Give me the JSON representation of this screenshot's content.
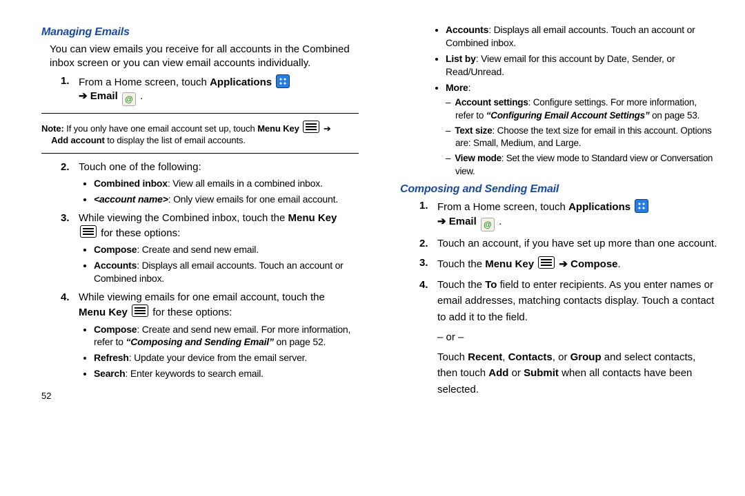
{
  "left": {
    "section_title": "Managing Emails",
    "intro": "You can view emails you receive for all accounts in the Combined inbox screen or you can view email accounts individually.",
    "step1_a": "From a Home screen, touch ",
    "step1_b": "Applications",
    "arrow": " ➔ ",
    "email_label": "Email",
    "period": " .",
    "note_bold": "Note:",
    "note_text_a": " If you only have one email account set up, touch ",
    "note_menu": "Menu Key",
    "note_text_b": "Add account",
    "note_text_c": " to display the list of email accounts.",
    "step2": "Touch one of the following:",
    "step2_b1_bold": "Combined inbox",
    "step2_b1_rest": ": View all emails in a combined inbox.",
    "step2_b2_tag": "<account name>",
    "step2_b2_rest": ": Only view emails for one email account.",
    "step3_a": "While viewing the Combined inbox, touch the ",
    "step3_b": "Menu Key",
    "step3_c": " for these options:",
    "s3b1_bold": "Compose",
    "s3b1_rest": ": Create and send new email.",
    "s3b2_bold": "Accounts",
    "s3b2_rest": ": Displays all email accounts. Touch an account or Combined inbox.",
    "step4_a": "While viewing emails for one email account, touch the ",
    "step4_b": "Menu Key",
    "step4_c": "  for these options:",
    "s4b1_bold": "Compose",
    "s4b1_rest": ": Create and send new email. For more information, refer to ",
    "s4b1_ref": "“Composing and Sending Email”",
    "s4b1_pg": "  on page 52.",
    "s4b2_bold": "Refresh",
    "s4b2_rest": ": Update your device from the email server.",
    "s4b3_bold": "Search",
    "s4b3_rest": ": Enter keywords to search email.",
    "page_num": "52"
  },
  "right": {
    "r_b1_bold": "Accounts",
    "r_b1_rest": ": Displays all email accounts. Touch an account or Combined inbox.",
    "r_b2_bold": "List by",
    "r_b2_rest": ": View email for this account by Date, Sender, or Read/Unread.",
    "r_b3_bold": "More",
    "r_b3_rest": ":",
    "r_d1_bold": "Account settings",
    "r_d1_rest": ": Configure settings. For more information, refer to ",
    "r_d1_ref": "“Configuring Email Account Settings”",
    "r_d1_pg": "  on page 53.",
    "r_d2_bold": "Text size",
    "r_d2_rest": ": Choose the text size for email in this account. Options are: Small, Medium, and Large.",
    "r_d3_bold": "View mode",
    "r_d3_rest": ": Set the view mode to Standard view or Conversation view.",
    "section_title": "Composing and Sending Email",
    "step1_a": "From a Home screen, touch ",
    "step1_b": "Applications",
    "arrow": " ➔ ",
    "email_label": "Email",
    "period": " .",
    "step2": "Touch an account, if you have set up more than one account.",
    "step3_a": "Touch the ",
    "step3_b": "Menu Key",
    "step3_c": " ➔ ",
    "step3_d": "Compose",
    "step3_e": ".",
    "step4_a": "Touch the ",
    "step4_b": "To",
    "step4_c": " field to enter recipients. As you enter names or email addresses, matching contacts display. Touch a contact to add it to the field.",
    "or": "– or –",
    "step4_d_a": "Touch ",
    "step4_d_b": "Recent",
    "step4_d_c": ", ",
    "step4_d_d": "Contacts",
    "step4_d_e": ", or ",
    "step4_d_f": "Group",
    "step4_d_g": " and select contacts, then touch ",
    "step4_d_h": "Add",
    "step4_d_i": " or ",
    "step4_d_j": "Submit",
    "step4_d_k": " when all contacts have been selected."
  }
}
